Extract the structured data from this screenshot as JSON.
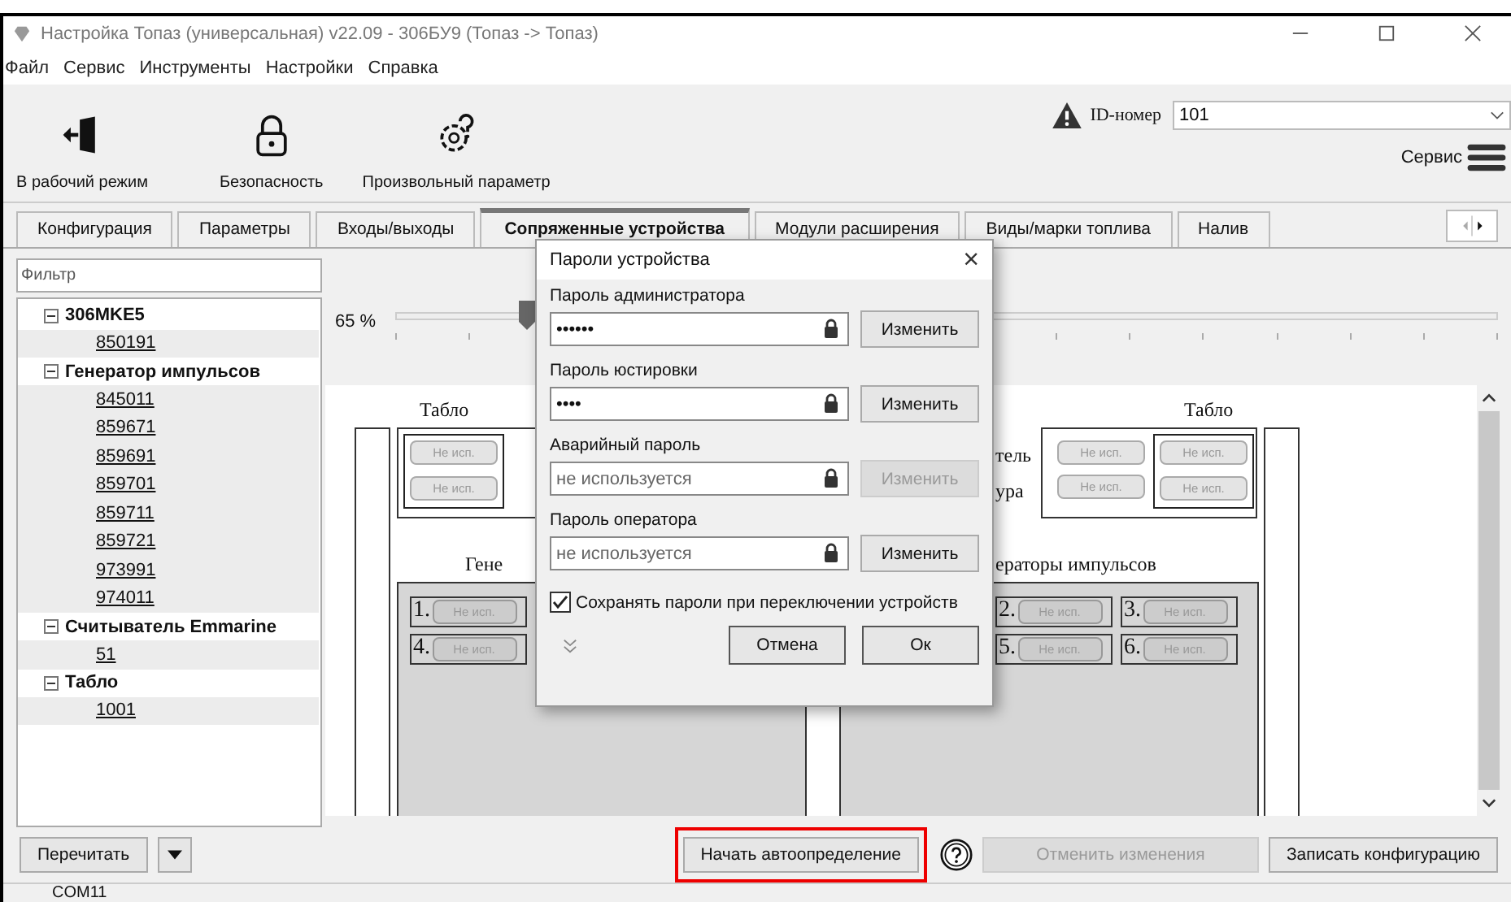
{
  "window": {
    "title": "Настройка Топаз (универсальная) v22.09 - 306БУ9 (Топаз -> Топаз)"
  },
  "menu": [
    "Файл",
    "Сервис",
    "Инструменты",
    "Настройки",
    "Справка"
  ],
  "toolbar": [
    {
      "label": "В рабочий режим",
      "kind": "exit"
    },
    {
      "label": "Безопасность",
      "kind": "lock"
    },
    {
      "label": "Произвольный параметр",
      "kind": "gear"
    }
  ],
  "id_field": {
    "label": "ID-номер",
    "value": "101"
  },
  "service": {
    "label": "Сервис"
  },
  "tabs": [
    {
      "label": "Конфигурация",
      "selected": false
    },
    {
      "label": "Параметры",
      "selected": false
    },
    {
      "label": "Входы/выходы",
      "selected": false
    },
    {
      "label": "Сопряженные устройства",
      "selected": true
    },
    {
      "label": "Модули расширения",
      "selected": false
    },
    {
      "label": "Виды/марки топлива",
      "selected": false
    },
    {
      "label": "Налив",
      "selected": false
    }
  ],
  "filter": {
    "placeholder": "Фильтр"
  },
  "tree": [
    {
      "label": "306MKE5",
      "expanded": true,
      "children": [
        {
          "label": "850191"
        }
      ]
    },
    {
      "label": "Генератор импульсов",
      "expanded": true,
      "children": [
        {
          "label": "845011"
        },
        {
          "label": "859671"
        },
        {
          "label": "859691"
        },
        {
          "label": "859701"
        },
        {
          "label": "859711"
        },
        {
          "label": "859721"
        },
        {
          "label": "973991"
        },
        {
          "label": "974011"
        }
      ]
    },
    {
      "label": "Считыватель Emmarine",
      "expanded": true,
      "children": [
        {
          "label": "51"
        }
      ]
    },
    {
      "label": "Табло",
      "expanded": true,
      "children": [
        {
          "label": "1001"
        }
      ]
    }
  ],
  "zoom": {
    "reading": "65 %",
    "level": 0.12
  },
  "diagram": {
    "left": {
      "title": "Табло",
      "buttons": [
        "Не исп.",
        "Не исп."
      ],
      "group_label": "Гене",
      "slots": [
        {
          "number": "1.",
          "label": "Не исп."
        },
        {
          "number": "4.",
          "label": "Не исп."
        }
      ]
    },
    "right": {
      "side_labels": [
        "тель",
        "ура"
      ],
      "title": "Табло",
      "buttons": [
        "Не исп.",
        "Не исп.",
        "Не исп.",
        "Не исп."
      ],
      "group_label": "ераторы импульсов",
      "slots": [
        {
          "number": "2.",
          "label": "Не исп."
        },
        {
          "number": "3.",
          "label": "Не исп."
        },
        {
          "number": "5.",
          "label": "Не исп."
        },
        {
          "number": "6.",
          "label": "Не исп."
        }
      ]
    }
  },
  "dialog": {
    "title": "Пароли устройства",
    "close": "×",
    "fields": [
      {
        "label": "Пароль администратора",
        "value": "••••••",
        "button": "Изменить",
        "disabled": false
      },
      {
        "label": "Пароль юстировки",
        "value": "••••",
        "button": "Изменить",
        "disabled": false
      },
      {
        "label": "Аварийный пароль",
        "placeholder": "не используется",
        "button": "Изменить",
        "disabled": true
      },
      {
        "label": "Пароль оператора",
        "placeholder": "не используется",
        "button": "Изменить",
        "disabled": false
      }
    ],
    "checkbox": {
      "label": "Сохранять пароли при переключении устройств",
      "checked": true
    },
    "buttons": [
      "Отмена",
      "Ок"
    ]
  },
  "bottom": {
    "reread": "Перечитать",
    "actions": [
      {
        "label": "Начать автоопределение",
        "highlighted": true,
        "disabled": false
      },
      {
        "label": "Отменить изменения",
        "highlighted": false,
        "disabled": true
      },
      {
        "label": "Записать конфигурацию",
        "highlighted": false,
        "disabled": false
      }
    ]
  },
  "status_bar": {
    "port": "COM11"
  }
}
